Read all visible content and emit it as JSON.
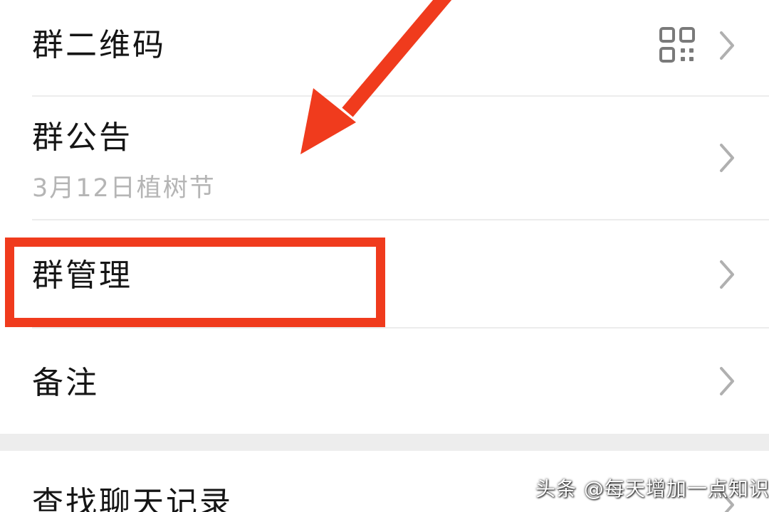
{
  "settings_list": {
    "items": [
      {
        "label": "群二维码"
      },
      {
        "label": "群公告",
        "subtitle": "3月12日植树节"
      },
      {
        "label": "群管理"
      },
      {
        "label": "备注"
      },
      {
        "label": "查找聊天记录"
      }
    ]
  },
  "icons": {
    "qr_code": "qr-code-icon",
    "chevron": "chevron-right-icon"
  },
  "annotation": {
    "highlight_color": "#f03b1d",
    "arrow_color": "#f03b1d"
  },
  "watermark": {
    "text": "头条 @每天增加一点知识"
  }
}
